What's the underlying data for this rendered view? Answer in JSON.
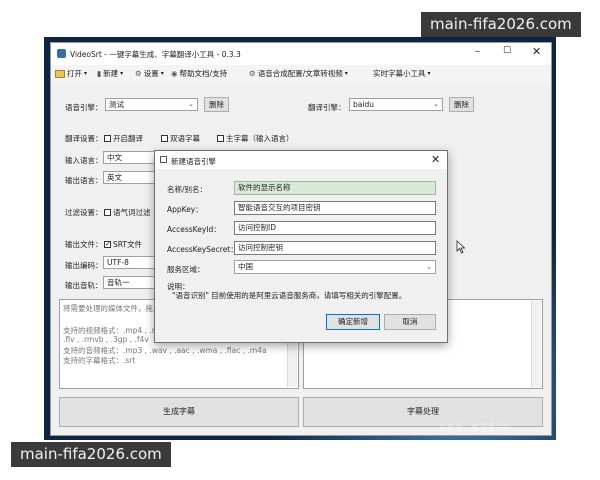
{
  "watermark": {
    "text": "main-fifa2026.com"
  },
  "window": {
    "title": "VideoSrt - 一键字幕生成、字幕翻译小工具 - 0.3.3"
  },
  "menu": {
    "open": "打开",
    "new": "新建",
    "settings": "设置",
    "help": "帮助文档/支持",
    "speech_config": "语音合成配置/文章转视频",
    "realtime": "实时字幕小工具"
  },
  "engine": {
    "label": "语音引擎：",
    "value": "测试",
    "delete": "删除"
  },
  "translate_engine": {
    "label": "翻译引擎：",
    "value": "baidu",
    "delete": "删除"
  },
  "translate_settings": {
    "label": "翻译设置：",
    "options": [
      "开启翻译",
      "双语字幕",
      "主字幕（输入语言）"
    ]
  },
  "input_lang": {
    "label": "输入语言：",
    "value": "中文"
  },
  "output_lang": {
    "label": "输出语言：",
    "value": "英文"
  },
  "filter": {
    "label": "过滤设置：",
    "option": "语气词过滤"
  },
  "output_file": {
    "label": "输出文件：",
    "option": "SRT文件"
  },
  "output_encoding": {
    "label": "输出编码：",
    "value": "UTF-8"
  },
  "output_track": {
    "label": "输出音轨：",
    "value": "音轨一"
  },
  "dropzone": {
    "hint": "将需要处理的媒体文件，拖入",
    "video_formats_a": "支持的视频格式：.mp4 , .mp",
    "video_formats_b": ".flv , .rmvb , .3gp , .f4v",
    "audio_formats": "支持的音频格式：.mp3 , .wav , .aac , .wma , .flac , .m4a",
    "subtitle_formats": "支持的字幕格式：.srt"
  },
  "actions": {
    "generate": "生成字幕",
    "process": "字幕处理"
  },
  "faint_watermark": "头条号：繁华落尽的",
  "dialog": {
    "title": "新建语音引擎",
    "name_label": "名称/别名：",
    "name_value": "软件的显示名称",
    "appkey_label": "AppKey：",
    "appkey_value": "智能语音交互的项目密钥",
    "keyid_label": "AccessKeyId：",
    "keyid_value": "访问控制ID",
    "secret_label": "AccessKeySecret：",
    "secret_value": "访问控制密钥",
    "region_label": "服务区域：",
    "region_value": "中国",
    "note_label": "说明：",
    "note_text": "\"语音识别\" 目前使用的是阿里云语音服务商，请填写相关的引擎配置。",
    "ok": "确定新增",
    "cancel": "取消"
  },
  "colors": {
    "highlight_field": "#d8ead6",
    "backdrop": "#0f2440"
  }
}
